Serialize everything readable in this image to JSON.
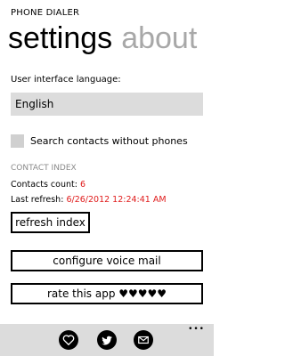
{
  "app": {
    "title": "PHONE DIALER"
  },
  "pivots": {
    "settings": "settings",
    "about": "about"
  },
  "language": {
    "label": "User interface language:",
    "selected": "English"
  },
  "search_contacts": {
    "label": "Search contacts without phones",
    "checked": false
  },
  "contact_index": {
    "header": "CONTACT INDEX",
    "count_label": "Contacts count:",
    "count_value": "6",
    "refresh_label": "Last refresh:",
    "refresh_value": "6/26/2012 12:24:41 AM"
  },
  "buttons": {
    "refresh_index": "refresh index",
    "configure_voicemail": "configure voice mail",
    "rate_app": "rate this app ♥♥♥♥♥"
  },
  "appbar": {
    "more": "•••",
    "icons": [
      "heart-icon",
      "twitter-icon",
      "mail-icon"
    ]
  },
  "colors": {
    "accent_red": "#e01b1b",
    "field_bg": "#dcdcdc",
    "inactive_pivot": "#a8a8a8"
  }
}
